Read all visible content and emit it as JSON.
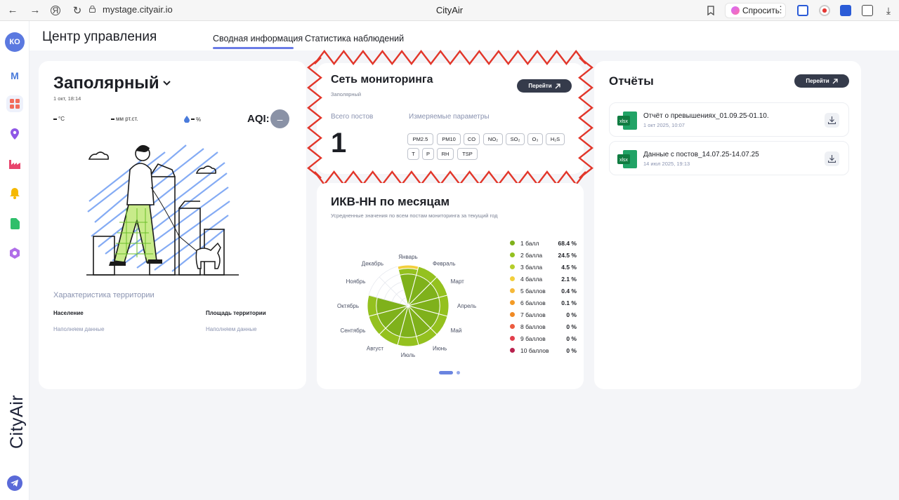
{
  "browser": {
    "url": "mystage.cityair.io",
    "title": "CityAir",
    "ask_label": "Спросить"
  },
  "sidebar": {
    "avatar_initials": "КО",
    "m_letter": "M",
    "brand": "CityAir",
    "items": [
      {
        "icon": "m-logo-icon"
      },
      {
        "icon": "dashboard-icon",
        "active": true
      },
      {
        "icon": "map-pin-icon"
      },
      {
        "icon": "factory-icon"
      },
      {
        "icon": "bell-icon"
      },
      {
        "icon": "document-icon"
      },
      {
        "icon": "hexagon-icon"
      }
    ]
  },
  "header": {
    "title": "Центр управления",
    "tabs": [
      {
        "label": "Сводная информация",
        "active": true
      },
      {
        "label": "Статистика наблюдений",
        "active": false
      }
    ]
  },
  "location": {
    "city": "Заполярный",
    "datetime": "1 окт, 18:14",
    "temperature_unit": "°С",
    "pressure_unit": "мм рт.ст.",
    "humidity_unit": "%",
    "aqi_label": "AQI:",
    "aqi_value": "–",
    "territory_title": "Характеристика территории",
    "population_label": "Население",
    "population_value": "Наполняем данные",
    "area_label": "Площадь территории",
    "area_value": "Наполняем данные"
  },
  "network": {
    "title": "Сеть мониторинга",
    "subtitle": "Заполярный",
    "go_label": "Перейти",
    "posts_label": "Всего постов",
    "posts_value": "1",
    "params_label": "Измеряемые параметры",
    "params": [
      "PM2.5",
      "PM10",
      "CO",
      "NO₂",
      "SO₂",
      "O₃",
      "H₂S",
      "T",
      "P",
      "RH",
      "TSP"
    ]
  },
  "ikv": {
    "title": "ИКВ-НН по месяцам",
    "subtitle": "Усредненные значения по всем постам мониторинга за текущий год"
  },
  "chart_data": {
    "type": "polar-area",
    "categories": [
      "Январь",
      "Февраль",
      "Март",
      "Апрель",
      "Май",
      "Июнь",
      "Июль",
      "Август",
      "Сентябрь",
      "Октябрь",
      "Ноябрь",
      "Декабрь"
    ],
    "has_data": [
      true,
      true,
      true,
      true,
      true,
      true,
      true,
      true,
      true,
      true,
      false,
      false
    ],
    "legend": [
      {
        "label": "1 балл",
        "value": "68.4 %",
        "color": "#7fb11b"
      },
      {
        "label": "2 балла",
        "value": "24.5 %",
        "color": "#94c11f"
      },
      {
        "label": "3 балла",
        "value": "4.5 %",
        "color": "#b5cd2a"
      },
      {
        "label": "4 балла",
        "value": "2.1 %",
        "color": "#f2cf3c"
      },
      {
        "label": "5 баллов",
        "value": "0.4 %",
        "color": "#f5b93a"
      },
      {
        "label": "6 баллов",
        "value": "0.1 %",
        "color": "#f39b26"
      },
      {
        "label": "7 баллов",
        "value": "0 %",
        "color": "#f08a24"
      },
      {
        "label": "8 баллов",
        "value": "0 %",
        "color": "#ec5b3f"
      },
      {
        "label": "9 баллов",
        "value": "0 %",
        "color": "#e23f4c"
      },
      {
        "label": "10 баллов",
        "value": "0 %",
        "color": "#b8224e"
      }
    ]
  },
  "reports": {
    "title": "Отчёты",
    "go_label": "Перейти",
    "items": [
      {
        "name": "Отчёт о превышениях_01.09.25-01.10.",
        "date": "1 окт 2025, 10:07",
        "file_label": "xlsx"
      },
      {
        "name": "Данные с постов_14.07.25-14.07.25",
        "date": "14 июл 2025, 19:13",
        "file_label": "xlsx"
      }
    ]
  }
}
